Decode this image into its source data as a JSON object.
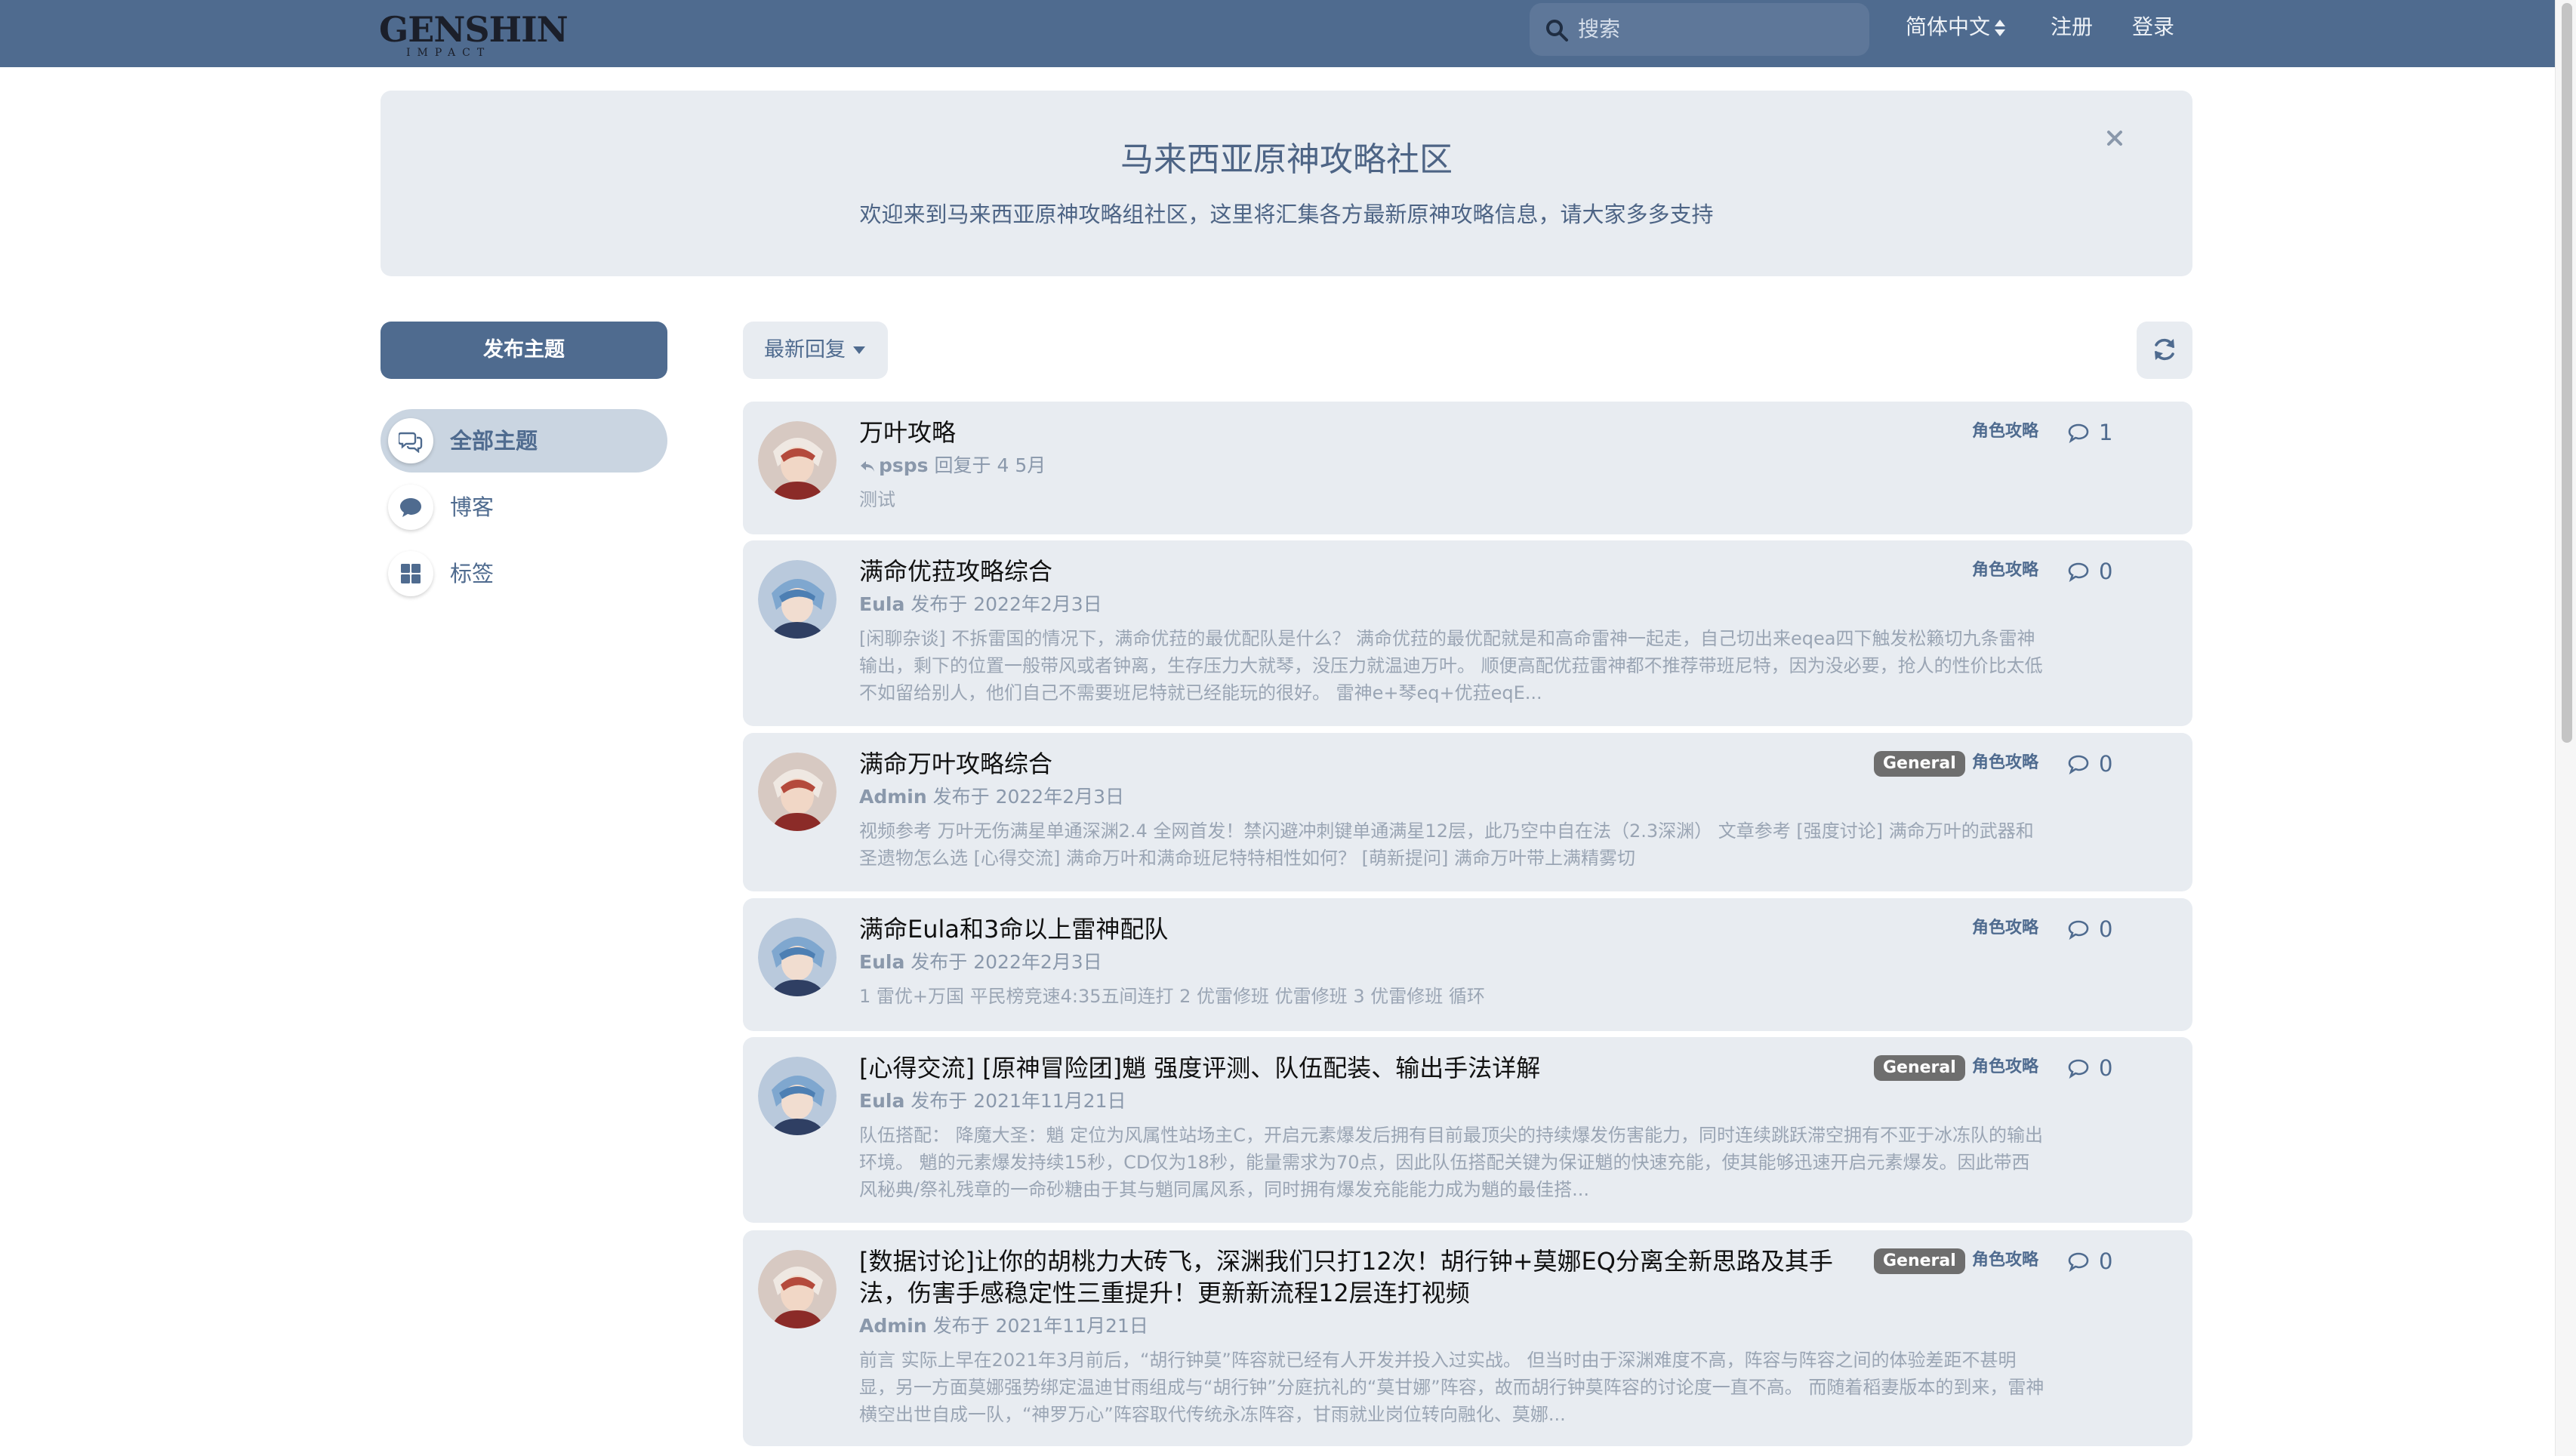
{
  "header": {
    "logo_line1": "GENSHIN",
    "logo_line2": "IMPACT",
    "search_placeholder": "搜索",
    "language": "简体中文",
    "signup": "注册",
    "login": "登录"
  },
  "hero": {
    "title": "马来西亚原神攻略社区",
    "subtitle": "欢迎来到马来西亚原神攻略组社区，这里将汇集各方最新原神攻略信息，请大家多多支持"
  },
  "sidebar": {
    "post_button": "发布主题",
    "items": [
      {
        "label": "全部主题",
        "icon": "discussions-icon",
        "active": true
      },
      {
        "label": "博客",
        "icon": "blog-icon",
        "active": false
      },
      {
        "label": "标签",
        "icon": "tags-icon",
        "active": false
      }
    ]
  },
  "toolbar": {
    "sort_label": "最新回复",
    "refresh_icon": "refresh-icon"
  },
  "topics": [
    {
      "title": "万叶攻略",
      "author": "psps",
      "meta_action": "回复于",
      "meta_time": "4 5月",
      "is_reply": true,
      "excerpt": "测试",
      "badge": "",
      "tag": "角色攻略",
      "count": "1",
      "avatar": "kazuha"
    },
    {
      "title": "满命优菈攻略综合",
      "author": "Eula",
      "meta_action": "发布于",
      "meta_time": "2022年2月3日",
      "is_reply": false,
      "excerpt": "[闲聊杂谈] 不拆雷国的情况下，满命优菈的最优配队是什么？ 满命优菈的最优配就是和高命雷神一起走，自己切出来eqea四下触发松籁切九条雷神输出，剩下的位置一般带风或者钟离，生存压力大就琴，没压力就温迪万叶。 顺便高配优菈雷神都不推荐带班尼特，因为没必要，抢人的性价比太低不如留给别人，他们自己不需要班尼特就已经能玩的很好。 雷神e+琴eq+优菈eqE...",
      "badge": "",
      "tag": "角色攻略",
      "count": "0",
      "avatar": "eula"
    },
    {
      "title": "满命万叶攻略综合",
      "author": "Admin",
      "meta_action": "发布于",
      "meta_time": "2022年2月3日",
      "is_reply": false,
      "excerpt": "视频参考 万叶无伤满星单通深渊2.4 全网首发！禁闪避冲刺键单通满星12层，此乃空中自在法（2.3深渊） 文章参考 [强度讨论] 满命万叶的武器和圣遗物怎么选 [心得交流] 满命万叶和满命班尼特特相性如何？ [萌新提问] 满命万叶带上满精雾切",
      "badge": "General",
      "tag": "角色攻略",
      "count": "0",
      "avatar": "kazuha"
    },
    {
      "title": "满命Eula和3命以上雷神配队",
      "author": "Eula",
      "meta_action": "发布于",
      "meta_time": "2022年2月3日",
      "is_reply": false,
      "excerpt": "1 雷优+万国 平民榜竞速4:35五间连打 2 优雷修班 优雷修班 3 优雷修班 循环",
      "badge": "",
      "tag": "角色攻略",
      "count": "0",
      "avatar": "eula"
    },
    {
      "title": "[心得交流] [原神冒险团]魈 强度评测、队伍配装、输出手法详解",
      "author": "Eula",
      "meta_action": "发布于",
      "meta_time": "2021年11月21日",
      "is_reply": false,
      "excerpt": "队伍搭配： 降魔大圣：魈 定位为风属性站场主C，开启元素爆发后拥有目前最顶尖的持续爆发伤害能力，同时连续跳跃滞空拥有不亚于冰冻队的输出环境。 魈的元素爆发持续15秒，CD仅为18秒，能量需求为70点，因此队伍搭配关键为保证魈的快速充能，使其能够迅速开启元素爆发。因此带西风秘典/祭礼残章的一命砂糖由于其与魈同属风系，同时拥有爆发充能能力成为魈的最佳搭...",
      "badge": "General",
      "tag": "角色攻略",
      "count": "0",
      "avatar": "eula"
    },
    {
      "title": "[数据讨论]让你的胡桃力大砖飞，深渊我们只打12次！胡行钟+莫娜EQ分离全新思路及其手法，伤害手感稳定性三重提升！更新新流程12层连打视频",
      "author": "Admin",
      "meta_action": "发布于",
      "meta_time": "2021年11月21日",
      "is_reply": false,
      "excerpt": "前言 实际上早在2021年3月前后，“胡行钟莫”阵容就已经有人开发并投入过实战。 但当时由于深渊难度不高，阵容与阵容之间的体验差距不甚明显，另一方面莫娜强势绑定温迪甘雨组成与“胡行钟”分庭抗礼的“莫甘娜”阵容，故而胡行钟莫阵容的讨论度一直不高。 而随着稻妻版本的到来，雷神横空出世自成一队，“神罗万心”阵容取代传统永冻阵容，甘雨就业岗位转向融化、莫娜...",
      "badge": "General",
      "tag": "角色攻略",
      "count": "0",
      "avatar": "kazuha"
    }
  ],
  "colors": {
    "header_bg": "#4f6b8f",
    "accent": "#4f6b8f",
    "card_bg": "#e8ecf1",
    "badge_bg": "#6e6e6e"
  }
}
